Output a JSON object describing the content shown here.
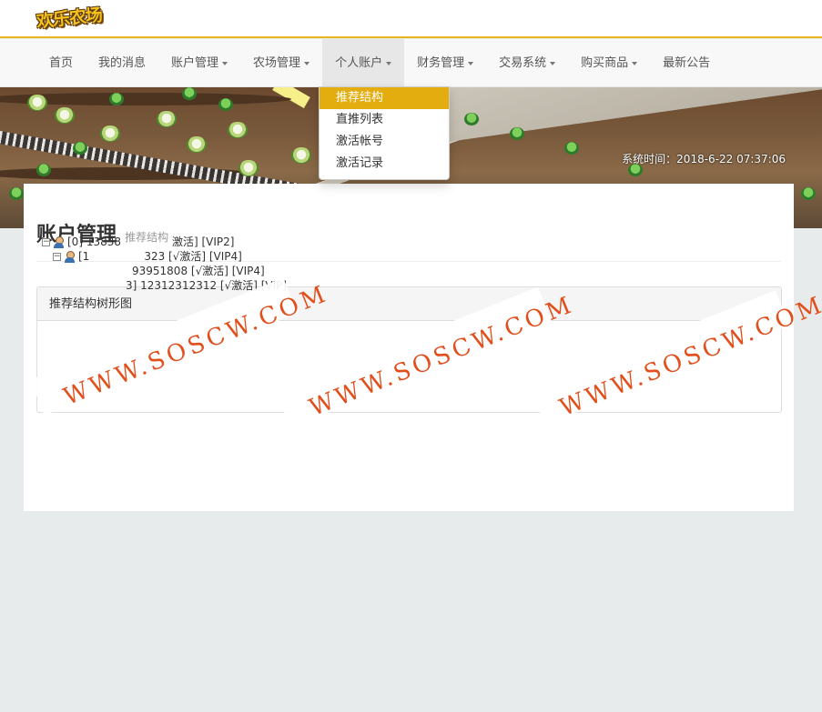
{
  "header": {
    "logo_text": "欢乐农场"
  },
  "nav": {
    "items": [
      {
        "label": "首页",
        "has_caret": false
      },
      {
        "label": "我的消息",
        "has_caret": false
      },
      {
        "label": "账户管理",
        "has_caret": true
      },
      {
        "label": "农场管理",
        "has_caret": true
      },
      {
        "label": "个人账户",
        "has_caret": true,
        "active": true
      },
      {
        "label": "财务管理",
        "has_caret": true
      },
      {
        "label": "交易系统",
        "has_caret": true
      },
      {
        "label": "购买商品",
        "has_caret": true
      },
      {
        "label": "最新公告",
        "has_caret": false
      }
    ]
  },
  "dropdown": {
    "items": [
      {
        "label": "推荐结构",
        "active": true
      },
      {
        "label": "直推列表"
      },
      {
        "label": "激活帐号"
      },
      {
        "label": "激活记录"
      }
    ]
  },
  "banner": {
    "system_time": "系统时间：2018-6-22 07:37:06"
  },
  "page": {
    "title": "账户管理",
    "subtitle": "推荐结构"
  },
  "panel": {
    "heading": "推荐结构树形图"
  },
  "tree": {
    "nodes": [
      {
        "text": "[0] 13838",
        "suffix": "激活] [VIP2]"
      },
      {
        "text": "[1",
        "suffix": "323 [√激活] [VIP4]"
      },
      {
        "text": "",
        "suffix": "93951808 [√激活] [VIP4]"
      },
      {
        "text": "",
        "suffix": "3] 12312312312 [√激活] [VIP]"
      }
    ]
  },
  "watermark": {
    "text": "WWW.SOSCW.COM"
  },
  "colors": {
    "accent": "#e4ad0f",
    "watermark": "#e04f1c",
    "page_bg": "#e8ebeb"
  }
}
